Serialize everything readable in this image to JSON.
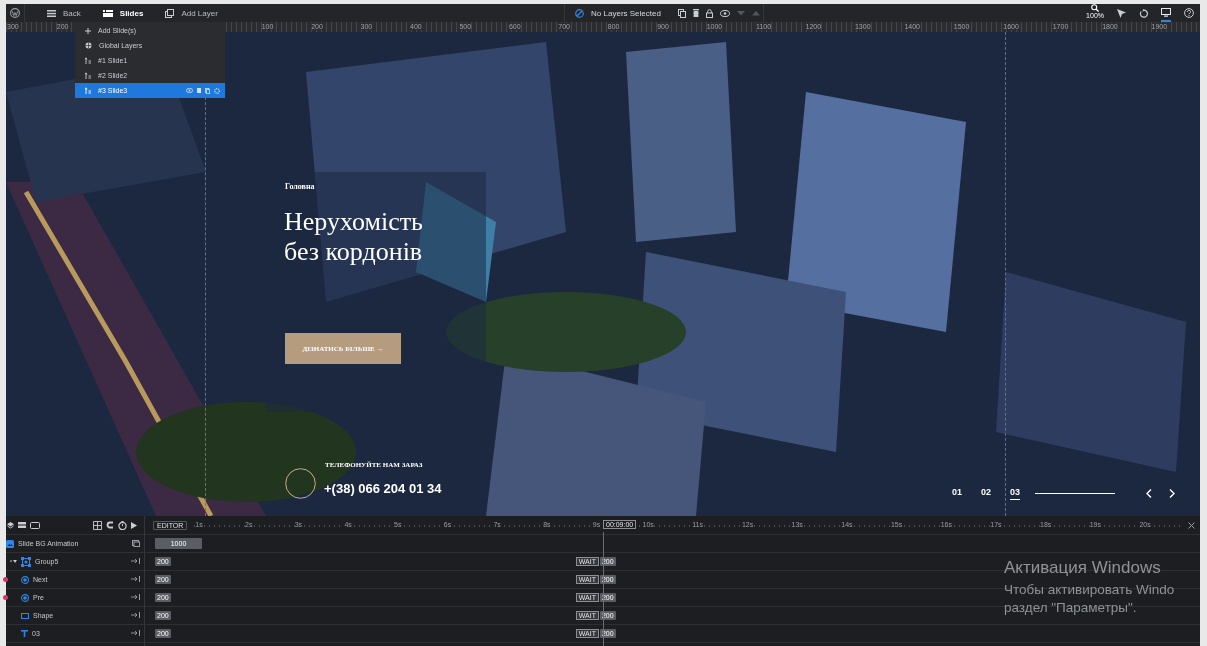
{
  "toolbar": {
    "items": [
      {
        "kind": "back",
        "label": "Back",
        "selected": false
      },
      {
        "kind": "slides",
        "label": "Slides",
        "selected": true
      },
      {
        "kind": "add-layer",
        "label": "Add Layer",
        "selected": false
      }
    ],
    "layer_status": "No Layers Selected",
    "zoom_level": "100%",
    "desktop_view": {
      "selected": true
    }
  },
  "ruler": {
    "left_labels": [
      "300",
      "200"
    ],
    "labels": [
      "100",
      "200",
      "300",
      "400",
      "500",
      "600",
      "700",
      "800",
      "900",
      "1000",
      "1100",
      "1200",
      "1300",
      "1400",
      "1500",
      "1600",
      "1700",
      "1800",
      "1900"
    ]
  },
  "slide_menu": {
    "items": [
      {
        "kind": "add",
        "label": "Add Slide(s)",
        "selected": false
      },
      {
        "kind": "global",
        "label": "Global Layers",
        "selected": false
      },
      {
        "kind": "slide",
        "label": "#1 Slide1",
        "selected": false
      },
      {
        "kind": "slide",
        "label": "#2 Slide2",
        "selected": false
      },
      {
        "kind": "slide",
        "label": "#3 Slide3",
        "selected": true
      }
    ]
  },
  "slide": {
    "eyebrow": "Головна",
    "heading": "Нерухомість без кордонів",
    "button": "ДІЗНАТИСЬ БІЛЬШЕ →",
    "phone_label": "ТЕЛЕФОНУЙТЕ НАМ ЗАРАЗ",
    "phone": "+(38) 066 204 01 34",
    "nav": [
      {
        "label": "01",
        "selected": false
      },
      {
        "label": "02",
        "selected": false
      },
      {
        "label": "03",
        "selected": true
      }
    ]
  },
  "timeline": {
    "mode": "EDITOR",
    "ticks": [
      "1s",
      "2s",
      "3s",
      "4s",
      "5s",
      "6s",
      "7s",
      "8s",
      "9s",
      "10s",
      "11s",
      "12s",
      "13s",
      "14s",
      "15s",
      "16s",
      "17s",
      "18s",
      "19s",
      "20s"
    ],
    "playhead": "00:09:00",
    "rows": [
      {
        "kind": "bg",
        "label": "Slide BG Animation",
        "duration": "1000"
      },
      {
        "kind": "group",
        "label": "Group5",
        "expanded": true,
        "start": "200",
        "wait": "WAIT",
        "end": "200",
        "children": [
          {
            "kind": "button",
            "label": "Next",
            "flagged": true,
            "start": "200",
            "wait": "WAIT",
            "end": "200"
          },
          {
            "kind": "button",
            "label": "Pre",
            "flagged": true,
            "start": "200",
            "wait": "WAIT",
            "end": "200"
          },
          {
            "kind": "shape",
            "label": "Shape",
            "flagged": false,
            "start": "200",
            "wait": "WAIT",
            "end": "200"
          },
          {
            "kind": "text",
            "label": "03",
            "flagged": false,
            "start": "200",
            "wait": "WAIT",
            "end": "200"
          }
        ]
      }
    ]
  },
  "activation": {
    "title": "Активация Windows",
    "lines": [
      "Чтобы активировать Windo",
      "раздел \"Параметры\"."
    ]
  }
}
